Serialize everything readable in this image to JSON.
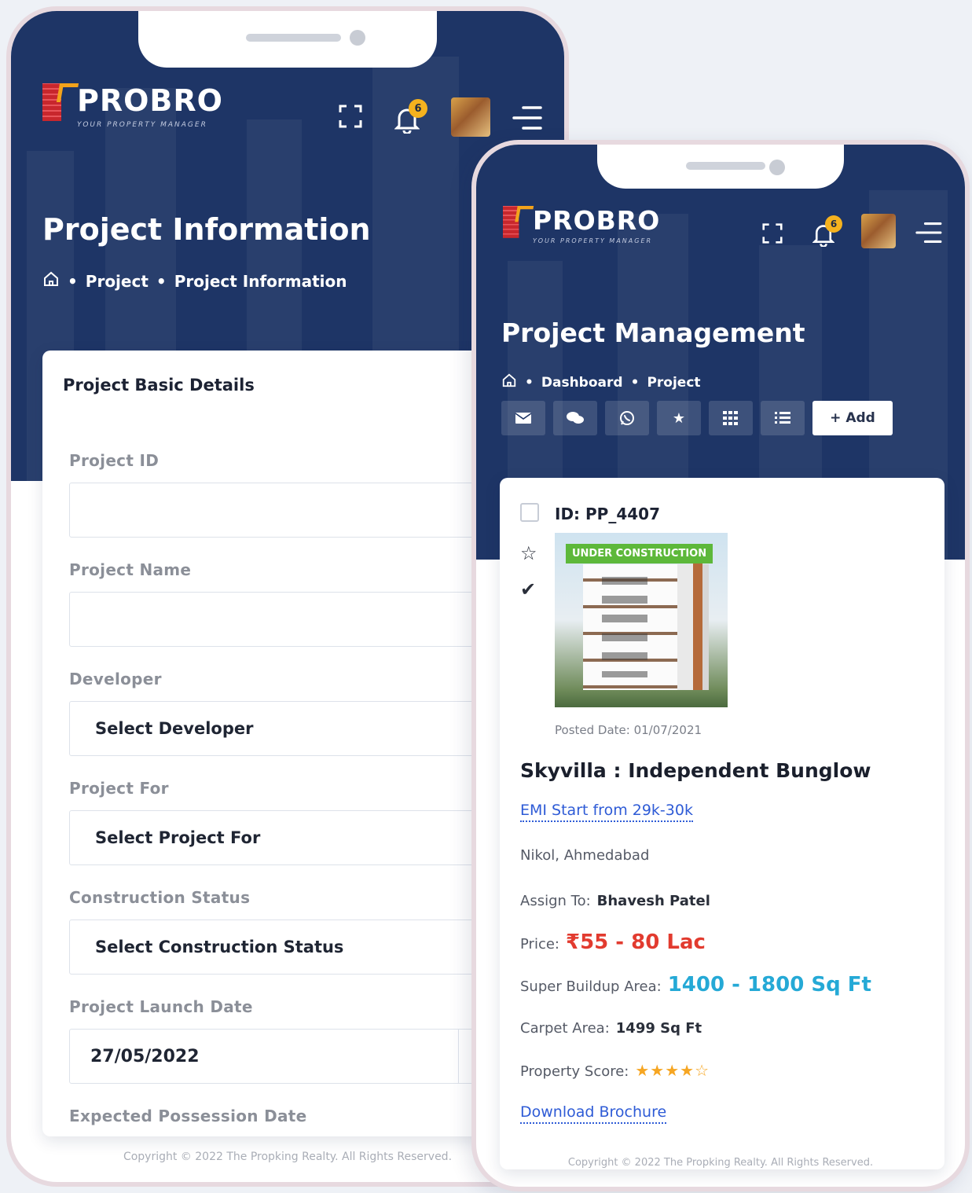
{
  "left_phone": {
    "logo": {
      "name": "PROBRO",
      "tagline": "YOUR PROPERTY MANAGER"
    },
    "header": {
      "fullscreen_icon": "expand-icon",
      "bell_icon": "bell-icon",
      "notification_count": "6",
      "menu_icon": "hamburger-icon"
    },
    "page_title": "Project Information",
    "breadcrumb": {
      "home_icon": "home-icon",
      "items": [
        "Project",
        "Project Information"
      ]
    },
    "card": {
      "section_title": "Project Basic Details",
      "fields": [
        {
          "label": "Project ID",
          "value": ""
        },
        {
          "label": "Project Name",
          "value": ""
        },
        {
          "label": "Developer",
          "value": "Select Developer"
        },
        {
          "label": "Project For",
          "value": "Select Project For"
        },
        {
          "label": "Construction Status",
          "value": "Select Construction Status"
        },
        {
          "label": "Project Launch Date",
          "value": "27/05/2022"
        },
        {
          "label": "Expected Possession Date",
          "value": ""
        }
      ]
    },
    "footer": "Copyright © 2022 The Propking Realty. All Rights Reserved."
  },
  "right_phone": {
    "logo": {
      "name": "PROBRO",
      "tagline": "YOUR PROPERTY MANAGER"
    },
    "header": {
      "fullscreen_icon": "expand-icon",
      "bell_icon": "bell-icon",
      "notification_count": "6",
      "menu_icon": "hamburger-icon"
    },
    "page_title": "Project Management",
    "breadcrumb": {
      "home_icon": "home-icon",
      "items": [
        "Dashboard",
        "Project"
      ]
    },
    "toolbar": {
      "icons": [
        "mail-icon",
        "chat-icon",
        "whatsapp-icon",
        "star-icon",
        "grid-icon",
        "list-icon"
      ],
      "add_label": "+ Add"
    },
    "property": {
      "id_text": "ID: PP_4407",
      "badge": "UNDER CONSTRUCTION",
      "posted": "Posted Date: 01/07/2021",
      "title": "Skyvilla : Independent Bunglow",
      "emi": "EMI Start from 29k-30k",
      "location": "Nikol, Ahmedabad",
      "assign_label": "Assign To:",
      "assign_value": "Bhavesh Patel",
      "price_label": "Price:",
      "price_value": "₹55 - 80 Lac",
      "super_area_label": "Super Buildup Area:",
      "super_area_value": "1400 - 1800 Sq Ft",
      "carpet_label": "Carpet Area:",
      "carpet_value": "1499 Sq Ft",
      "score_label": "Property Score:",
      "score_stars": "★★★★☆",
      "score_rating": 4,
      "score_max": 5,
      "brochure": "Download Brochure"
    },
    "footer": "Copyright © 2022 The Propking Realty. All Rights Reserved."
  },
  "colors": {
    "header_bg": "#1e3566",
    "accent_red": "#e23b2f",
    "accent_blue": "#25a9d6",
    "link": "#2e5bd6",
    "badge": "#f5b21e",
    "construction_tag": "#5db83a"
  }
}
